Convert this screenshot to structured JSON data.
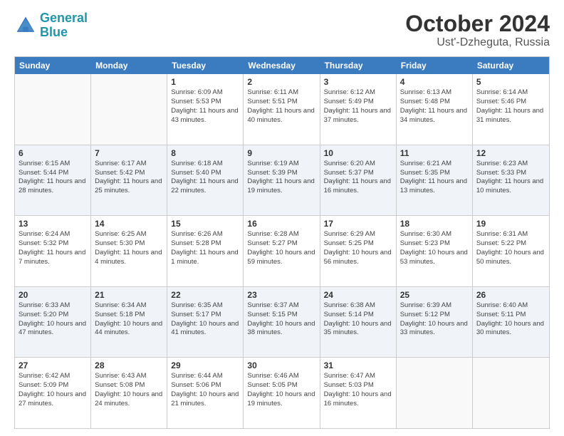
{
  "logo": {
    "line1": "General",
    "line2": "Blue"
  },
  "title": "October 2024",
  "subtitle": "Ust'-Dzheguta, Russia",
  "weekdays": [
    "Sunday",
    "Monday",
    "Tuesday",
    "Wednesday",
    "Thursday",
    "Friday",
    "Saturday"
  ],
  "rows": [
    [
      {
        "day": "",
        "sunrise": "",
        "sunset": "",
        "daylight": "",
        "alt": false
      },
      {
        "day": "",
        "sunrise": "",
        "sunset": "",
        "daylight": "",
        "alt": false
      },
      {
        "day": "1",
        "sunrise": "Sunrise: 6:09 AM",
        "sunset": "Sunset: 5:53 PM",
        "daylight": "Daylight: 11 hours and 43 minutes.",
        "alt": false
      },
      {
        "day": "2",
        "sunrise": "Sunrise: 6:11 AM",
        "sunset": "Sunset: 5:51 PM",
        "daylight": "Daylight: 11 hours and 40 minutes.",
        "alt": false
      },
      {
        "day": "3",
        "sunrise": "Sunrise: 6:12 AM",
        "sunset": "Sunset: 5:49 PM",
        "daylight": "Daylight: 11 hours and 37 minutes.",
        "alt": false
      },
      {
        "day": "4",
        "sunrise": "Sunrise: 6:13 AM",
        "sunset": "Sunset: 5:48 PM",
        "daylight": "Daylight: 11 hours and 34 minutes.",
        "alt": false
      },
      {
        "day": "5",
        "sunrise": "Sunrise: 6:14 AM",
        "sunset": "Sunset: 5:46 PM",
        "daylight": "Daylight: 11 hours and 31 minutes.",
        "alt": false
      }
    ],
    [
      {
        "day": "6",
        "sunrise": "Sunrise: 6:15 AM",
        "sunset": "Sunset: 5:44 PM",
        "daylight": "Daylight: 11 hours and 28 minutes.",
        "alt": true
      },
      {
        "day": "7",
        "sunrise": "Sunrise: 6:17 AM",
        "sunset": "Sunset: 5:42 PM",
        "daylight": "Daylight: 11 hours and 25 minutes.",
        "alt": true
      },
      {
        "day": "8",
        "sunrise": "Sunrise: 6:18 AM",
        "sunset": "Sunset: 5:40 PM",
        "daylight": "Daylight: 11 hours and 22 minutes.",
        "alt": true
      },
      {
        "day": "9",
        "sunrise": "Sunrise: 6:19 AM",
        "sunset": "Sunset: 5:39 PM",
        "daylight": "Daylight: 11 hours and 19 minutes.",
        "alt": true
      },
      {
        "day": "10",
        "sunrise": "Sunrise: 6:20 AM",
        "sunset": "Sunset: 5:37 PM",
        "daylight": "Daylight: 11 hours and 16 minutes.",
        "alt": true
      },
      {
        "day": "11",
        "sunrise": "Sunrise: 6:21 AM",
        "sunset": "Sunset: 5:35 PM",
        "daylight": "Daylight: 11 hours and 13 minutes.",
        "alt": true
      },
      {
        "day": "12",
        "sunrise": "Sunrise: 6:23 AM",
        "sunset": "Sunset: 5:33 PM",
        "daylight": "Daylight: 11 hours and 10 minutes.",
        "alt": true
      }
    ],
    [
      {
        "day": "13",
        "sunrise": "Sunrise: 6:24 AM",
        "sunset": "Sunset: 5:32 PM",
        "daylight": "Daylight: 11 hours and 7 minutes.",
        "alt": false
      },
      {
        "day": "14",
        "sunrise": "Sunrise: 6:25 AM",
        "sunset": "Sunset: 5:30 PM",
        "daylight": "Daylight: 11 hours and 4 minutes.",
        "alt": false
      },
      {
        "day": "15",
        "sunrise": "Sunrise: 6:26 AM",
        "sunset": "Sunset: 5:28 PM",
        "daylight": "Daylight: 11 hours and 1 minute.",
        "alt": false
      },
      {
        "day": "16",
        "sunrise": "Sunrise: 6:28 AM",
        "sunset": "Sunset: 5:27 PM",
        "daylight": "Daylight: 10 hours and 59 minutes.",
        "alt": false
      },
      {
        "day": "17",
        "sunrise": "Sunrise: 6:29 AM",
        "sunset": "Sunset: 5:25 PM",
        "daylight": "Daylight: 10 hours and 56 minutes.",
        "alt": false
      },
      {
        "day": "18",
        "sunrise": "Sunrise: 6:30 AM",
        "sunset": "Sunset: 5:23 PM",
        "daylight": "Daylight: 10 hours and 53 minutes.",
        "alt": false
      },
      {
        "day": "19",
        "sunrise": "Sunrise: 6:31 AM",
        "sunset": "Sunset: 5:22 PM",
        "daylight": "Daylight: 10 hours and 50 minutes.",
        "alt": false
      }
    ],
    [
      {
        "day": "20",
        "sunrise": "Sunrise: 6:33 AM",
        "sunset": "Sunset: 5:20 PM",
        "daylight": "Daylight: 10 hours and 47 minutes.",
        "alt": true
      },
      {
        "day": "21",
        "sunrise": "Sunrise: 6:34 AM",
        "sunset": "Sunset: 5:18 PM",
        "daylight": "Daylight: 10 hours and 44 minutes.",
        "alt": true
      },
      {
        "day": "22",
        "sunrise": "Sunrise: 6:35 AM",
        "sunset": "Sunset: 5:17 PM",
        "daylight": "Daylight: 10 hours and 41 minutes.",
        "alt": true
      },
      {
        "day": "23",
        "sunrise": "Sunrise: 6:37 AM",
        "sunset": "Sunset: 5:15 PM",
        "daylight": "Daylight: 10 hours and 38 minutes.",
        "alt": true
      },
      {
        "day": "24",
        "sunrise": "Sunrise: 6:38 AM",
        "sunset": "Sunset: 5:14 PM",
        "daylight": "Daylight: 10 hours and 35 minutes.",
        "alt": true
      },
      {
        "day": "25",
        "sunrise": "Sunrise: 6:39 AM",
        "sunset": "Sunset: 5:12 PM",
        "daylight": "Daylight: 10 hours and 33 minutes.",
        "alt": true
      },
      {
        "day": "26",
        "sunrise": "Sunrise: 6:40 AM",
        "sunset": "Sunset: 5:11 PM",
        "daylight": "Daylight: 10 hours and 30 minutes.",
        "alt": true
      }
    ],
    [
      {
        "day": "27",
        "sunrise": "Sunrise: 6:42 AM",
        "sunset": "Sunset: 5:09 PM",
        "daylight": "Daylight: 10 hours and 27 minutes.",
        "alt": false
      },
      {
        "day": "28",
        "sunrise": "Sunrise: 6:43 AM",
        "sunset": "Sunset: 5:08 PM",
        "daylight": "Daylight: 10 hours and 24 minutes.",
        "alt": false
      },
      {
        "day": "29",
        "sunrise": "Sunrise: 6:44 AM",
        "sunset": "Sunset: 5:06 PM",
        "daylight": "Daylight: 10 hours and 21 minutes.",
        "alt": false
      },
      {
        "day": "30",
        "sunrise": "Sunrise: 6:46 AM",
        "sunset": "Sunset: 5:05 PM",
        "daylight": "Daylight: 10 hours and 19 minutes.",
        "alt": false
      },
      {
        "day": "31",
        "sunrise": "Sunrise: 6:47 AM",
        "sunset": "Sunset: 5:03 PM",
        "daylight": "Daylight: 10 hours and 16 minutes.",
        "alt": false
      },
      {
        "day": "",
        "sunrise": "",
        "sunset": "",
        "daylight": "",
        "alt": false
      },
      {
        "day": "",
        "sunrise": "",
        "sunset": "",
        "daylight": "",
        "alt": false
      }
    ]
  ]
}
